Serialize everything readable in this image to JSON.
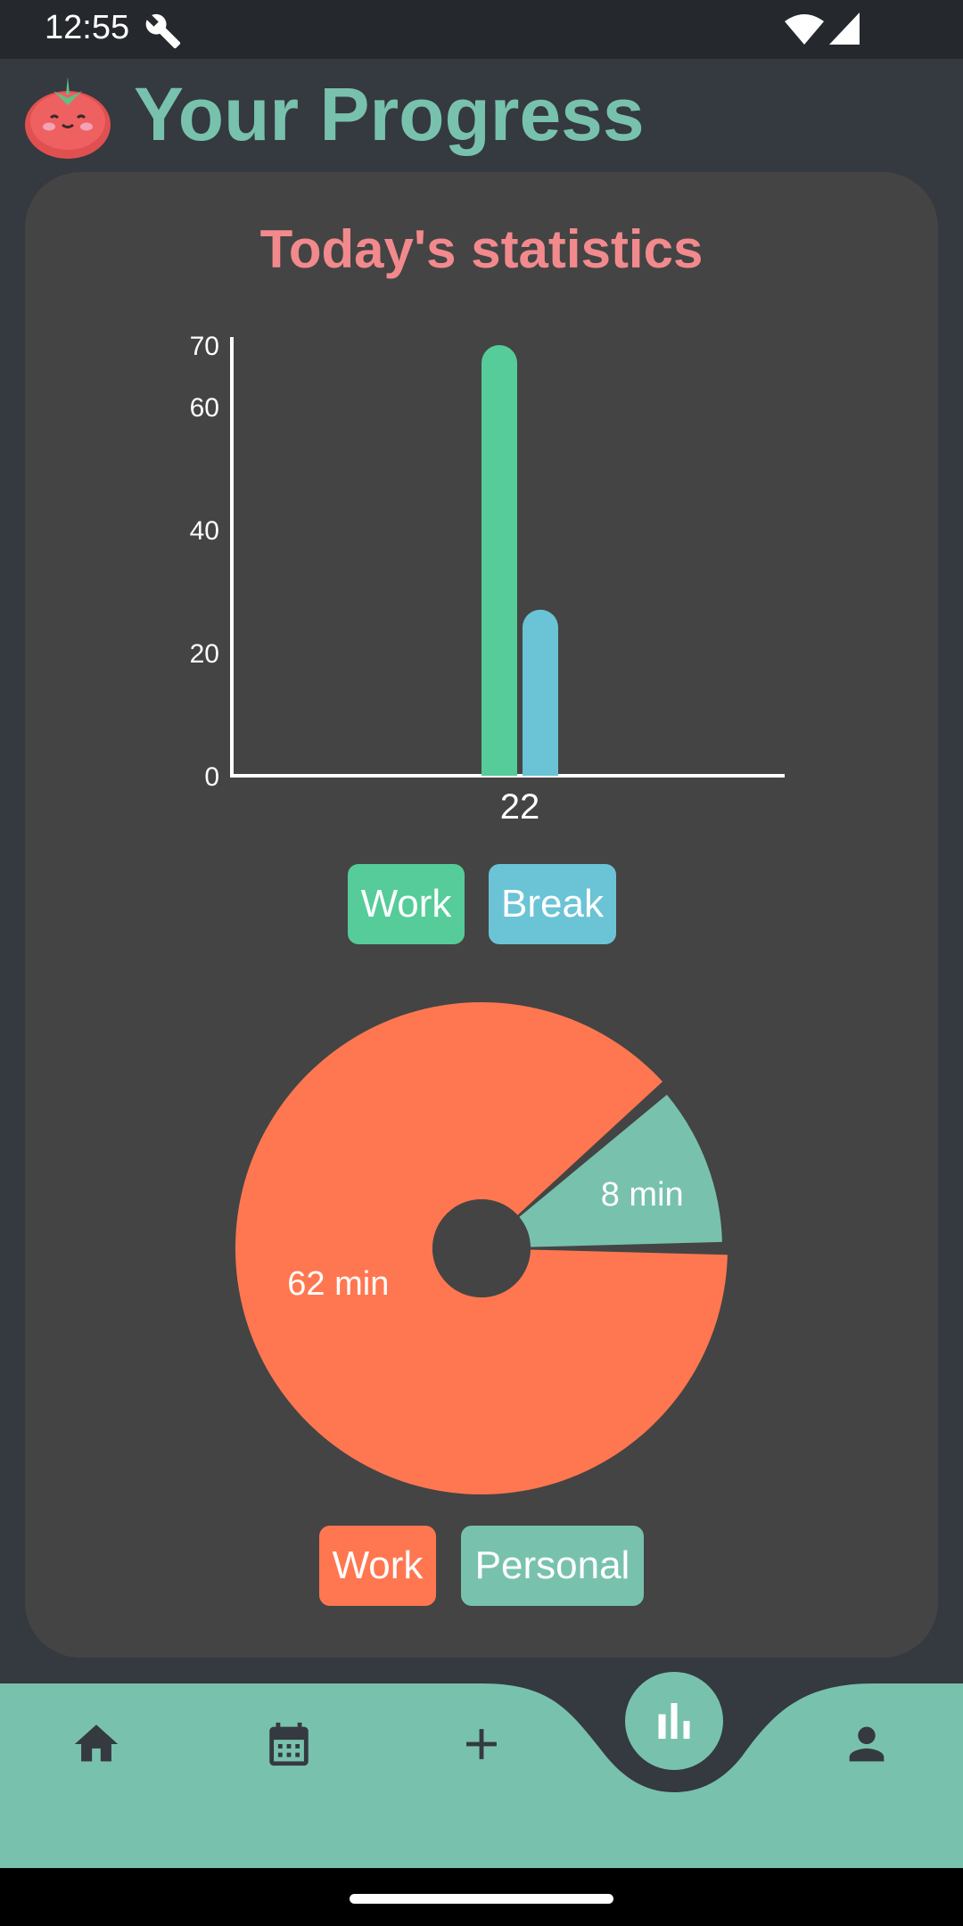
{
  "status_bar": {
    "time": "12:55",
    "icons": [
      "wrench-icon",
      "wifi-icon",
      "cellular-signal-icon"
    ]
  },
  "header": {
    "title": "Your Progress",
    "logo_icon": "tomato-mascot-icon"
  },
  "card": {
    "title": "Today's statistics"
  },
  "colors": {
    "background": "#353940",
    "card": "#444444",
    "accent": "#78c2ad",
    "title_pink": "#f28a8d",
    "work_bar": "#55cc99",
    "break_bar": "#6bc3d6",
    "work_pie": "#ff7750",
    "personal_pie": "#78c2ad"
  },
  "bar_legend": [
    {
      "label": "Work",
      "color": "#55cc99"
    },
    {
      "label": "Break",
      "color": "#6bc3d6"
    }
  ],
  "pie_legend": [
    {
      "label": "Work",
      "color": "#ff7750"
    },
    {
      "label": "Personal",
      "color": "#78c2ad"
    }
  ],
  "chart_data": [
    {
      "type": "bar",
      "categories": [
        "22"
      ],
      "series": [
        {
          "name": "Work",
          "values": [
            70
          ],
          "color": "#55cc99"
        },
        {
          "name": "Break",
          "values": [
            27
          ],
          "color": "#6bc3d6"
        }
      ],
      "y_ticks": [
        "0",
        "20",
        "40",
        "60",
        "70"
      ],
      "ylim": [
        0,
        70
      ],
      "grid": false,
      "legend": "bottom"
    },
    {
      "type": "pie",
      "slices": [
        {
          "name": "Work",
          "value": 62,
          "label": "62 min",
          "color": "#ff7750"
        },
        {
          "name": "Personal",
          "value": 8,
          "label": "8 min",
          "color": "#78c2ad"
        }
      ],
      "donut": true,
      "legend": "bottom"
    }
  ],
  "bottom_nav": {
    "items": [
      {
        "name": "home",
        "icon": "home-icon",
        "active": false
      },
      {
        "name": "calendar",
        "icon": "calendar-icon",
        "active": false
      },
      {
        "name": "add",
        "icon": "plus-icon",
        "active": false
      },
      {
        "name": "stats",
        "icon": "bar-chart-icon",
        "active": true
      },
      {
        "name": "profile",
        "icon": "person-icon",
        "active": false
      }
    ]
  }
}
